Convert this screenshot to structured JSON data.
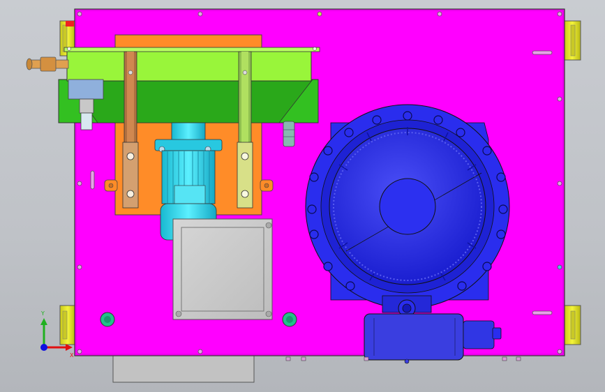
{
  "scene": {
    "colors": {
      "background": "#c4c7cc",
      "plate": "#ff00ff",
      "motor_frame": "#ff8c28",
      "gearbox": "#99f53a",
      "gearbox_dark": "#33c021",
      "motor": "#30e0f4",
      "valve": "#2a2dee",
      "valve_dark": "#1418b8",
      "actuator": "#3a3ee0",
      "panel": "#c9c9c9",
      "rail": "#e8e828",
      "fitting": "#e0a050",
      "green_port": "#22c08a"
    },
    "triad": {
      "x_label": "X",
      "y_label": "Y",
      "x_color": "#e01010",
      "y_color": "#20b020",
      "origin_color": "#1010e0"
    }
  }
}
